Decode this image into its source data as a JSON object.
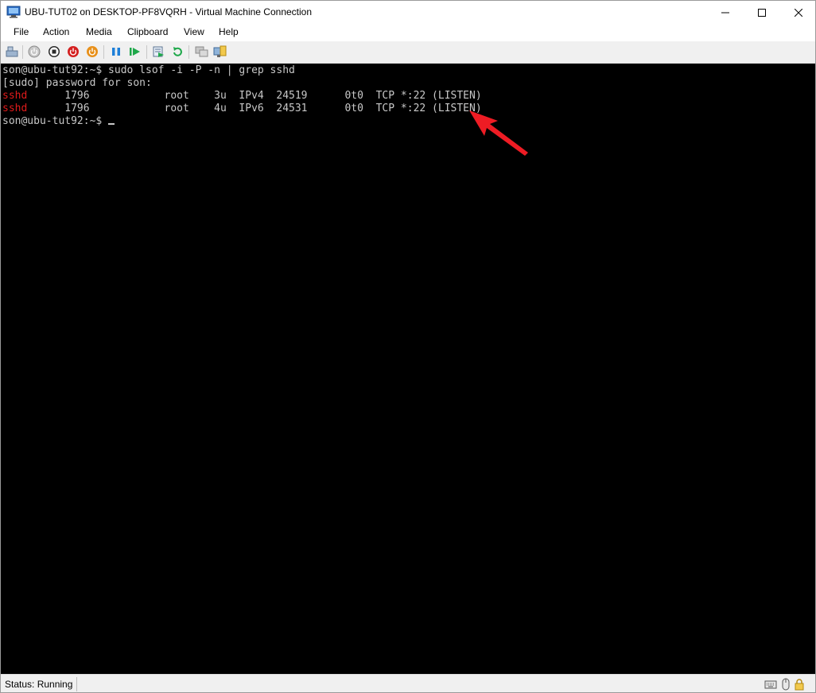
{
  "window": {
    "title": "UBU-TUT02 on DESKTOP-PF8VQRH - Virtual Machine Connection"
  },
  "menu": {
    "items": [
      "File",
      "Action",
      "Media",
      "Clipboard",
      "View",
      "Help"
    ]
  },
  "toolbar": {
    "buttons": [
      "ctrl-alt-del",
      "start",
      "turn-off",
      "shut-down",
      "save",
      "pause",
      "resume",
      "checkpoint",
      "revert",
      "enhanced-session",
      "basic-session"
    ]
  },
  "terminal": {
    "prompt_cmd": "son@ubu-tut92:~$ sudo lsof -i -P -n | grep sshd",
    "sudo_line": "[sudo] password for son:",
    "rows": [
      {
        "cmd": "sshd",
        "rest": "      1796            root    3u  IPv4  24519      0t0  TCP *:22 (LISTEN)"
      },
      {
        "cmd": "sshd",
        "rest": "      1796            root    4u  IPv6  24531      0t0  TCP *:22 (LISTEN)"
      }
    ],
    "prompt_end": "son@ubu-tut92:~$ "
  },
  "statusbar": {
    "status": "Status: Running"
  },
  "colors": {
    "terminal_bg": "#000000",
    "terminal_fg": "#c8c8c8",
    "highlight_red": "#e01b1b",
    "annotation_arrow": "#ee1c24"
  }
}
